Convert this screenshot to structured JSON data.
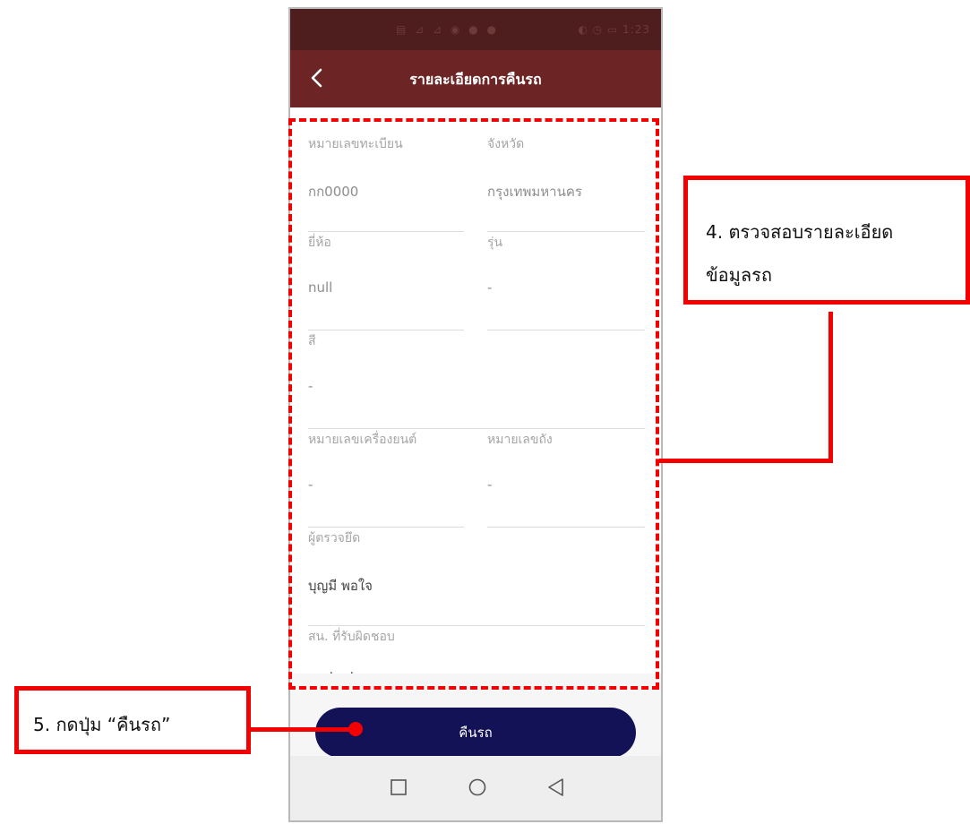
{
  "status_bar": {
    "left_icons": "▤ ⊿ ⊿ ◉ ● ●",
    "right_icons": "◐ ◷ ▭ 1:23"
  },
  "app_bar": {
    "title": "รายละเอียดการคืนรถ",
    "back_icon": "chevron-left-icon"
  },
  "fields": {
    "plate": {
      "label": "หมายเลขทะเบียน",
      "value": "กก0000"
    },
    "province": {
      "label": "จังหวัด",
      "value": "กรุงเทพมหานคร"
    },
    "brand": {
      "label": "ยี่ห้อ",
      "value": "null"
    },
    "model": {
      "label": "รุ่น",
      "value": "-"
    },
    "color": {
      "label": "สี",
      "value": "-"
    },
    "engine_no": {
      "label": "หมายเลขเครื่องยนต์",
      "value": "-"
    },
    "chassis_no": {
      "label": "หมายเลขถัง",
      "value": "-"
    },
    "inspector": {
      "label": "ผู้ตรวจยึด",
      "value": "บุญมี พอใจ"
    },
    "station": {
      "label": "สน. ที่รับผิดชอบ",
      "value": "สภ.testcase"
    }
  },
  "footer": {
    "return_button": "คืนรถ"
  },
  "nav_bar": {
    "icons": [
      "square-icon",
      "circle-icon",
      "triangle-back-icon"
    ]
  },
  "annotations": {
    "step4_line1": "4. ตรวจสอบรายละเอียด",
    "step4_line2": "ข้อมูลรถ",
    "step5": "5. กดปุ่ม “คืนรถ”",
    "highlight_color": "#f40000"
  },
  "colors": {
    "app_bar": "#6c2425",
    "status_bar": "#4e1d1d",
    "button": "#141257"
  }
}
